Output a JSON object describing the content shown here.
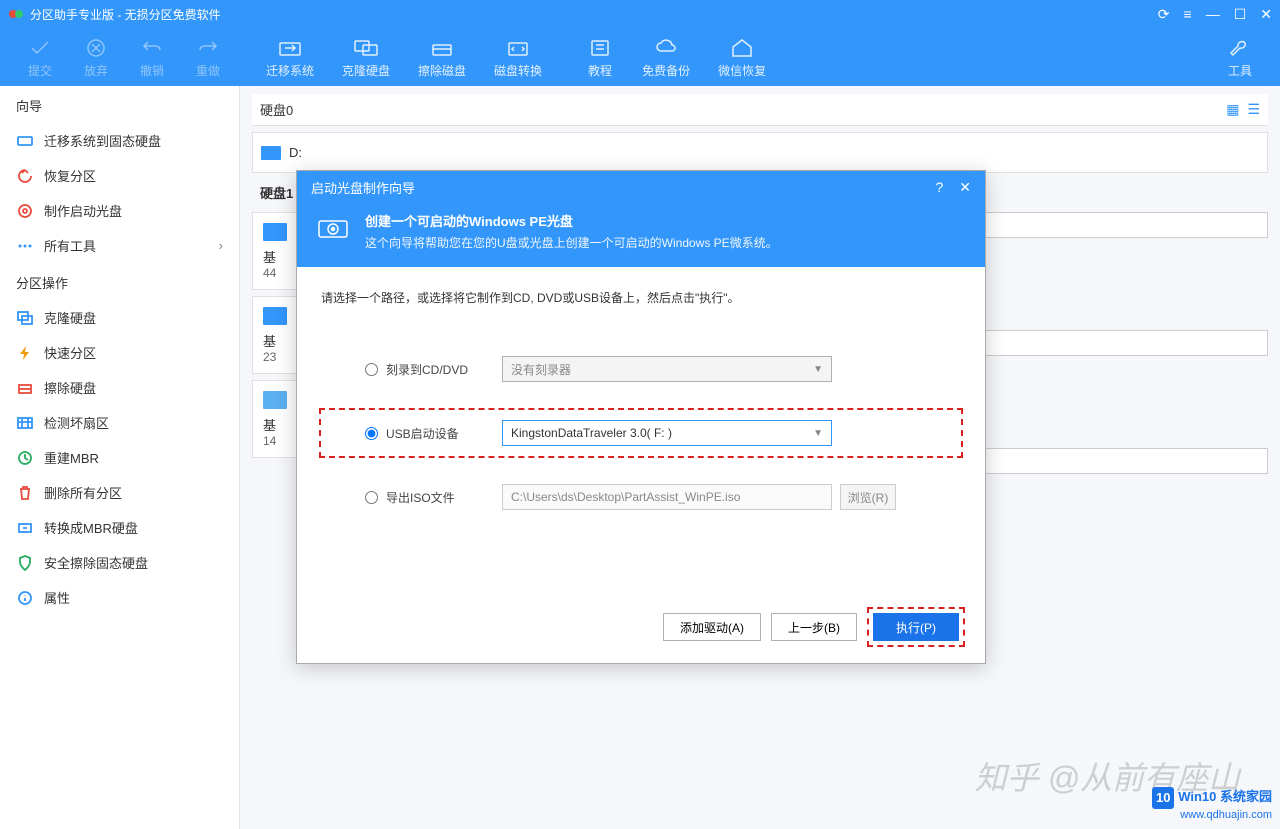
{
  "window": {
    "title": "分区助手专业版 - 无损分区免费软件"
  },
  "toolbar": {
    "submit": "提交",
    "discard": "放弃",
    "undo": "撤销",
    "redo": "重做",
    "migrate": "迁移系统",
    "clone_disk": "克隆硬盘",
    "wipe_disk": "擦除磁盘",
    "convert_disk": "磁盘转换",
    "tutorial": "教程",
    "free_backup": "免费备份",
    "wechat_recovery": "微信恢复",
    "tools": "工具"
  },
  "sidebar": {
    "section_wizard": "向导",
    "wizard_items": [
      "迁移系统到固态硬盘",
      "恢复分区",
      "制作启动光盘",
      "所有工具"
    ],
    "section_partition": "分区操作",
    "partition_items": [
      "克隆硬盘",
      "快速分区",
      "擦除硬盘",
      "检测坏扇区",
      "重建MBR",
      "删除所有分区",
      "转换成MBR硬盘",
      "安全擦除固态硬盘",
      "属性"
    ]
  },
  "content": {
    "disk0_label": "硬盘0",
    "drive_d": "D:",
    "disk1_label": "硬盘1",
    "basic_label": "基",
    "cap1": "44",
    "cap2": "23",
    "cap3": "14"
  },
  "dialog": {
    "title": "启动光盘制作向导",
    "banner_title": "创建一个可启动的Windows PE光盘",
    "banner_sub": "这个向导将帮助您在您的U盘或光盘上创建一个可启动的Windows PE微系统。",
    "instruction": "请选择一个路径，或选择将它制作到CD, DVD或USB设备上，然后点击\"执行\"。",
    "opt_cd": "刻录到CD/DVD",
    "opt_cd_value": "没有刻录器",
    "opt_usb": "USB启动设备",
    "opt_usb_value": "KingstonDataTraveler 3.0( F: )",
    "opt_iso": "导出ISO文件",
    "opt_iso_value": "C:\\Users\\ds\\Desktop\\PartAssist_WinPE.iso",
    "browse": "浏览(R)",
    "add_driver": "添加驱动(A)",
    "prev": "上一步(B)",
    "execute": "执行(P)"
  },
  "watermark": "知乎 @从前有座山",
  "corner_logo": {
    "brand": "Win10 系统家园",
    "url": "www.qdhuajin.com"
  }
}
